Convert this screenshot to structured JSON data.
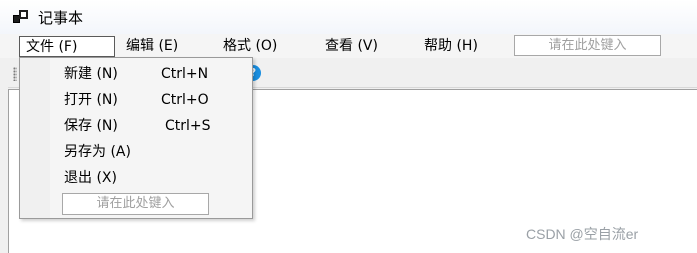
{
  "window": {
    "title": "记事本"
  },
  "menubar": {
    "items": [
      {
        "label": "文件 (F)"
      },
      {
        "label": "编辑 (E)"
      },
      {
        "label": "格式 (O)"
      },
      {
        "label": "查看 (V)"
      },
      {
        "label": "帮助 (H)"
      }
    ],
    "input_placeholder": "请在此处键入"
  },
  "file_menu": {
    "items": [
      {
        "label": "新建 (N)",
        "shortcut": "Ctrl+N"
      },
      {
        "label": "打开 (N)",
        "shortcut": "Ctrl+O"
      },
      {
        "label": "保存 (N)",
        "shortcut": "Ctrl+S"
      },
      {
        "label": "另存为 (A)",
        "shortcut": ""
      },
      {
        "label": "退出 (X)",
        "shortcut": ""
      }
    ],
    "input_placeholder": "请在此处键入"
  },
  "toolbar": {
    "help_icon_glyph": "?"
  },
  "watermark": "CSDN @空自流er"
}
